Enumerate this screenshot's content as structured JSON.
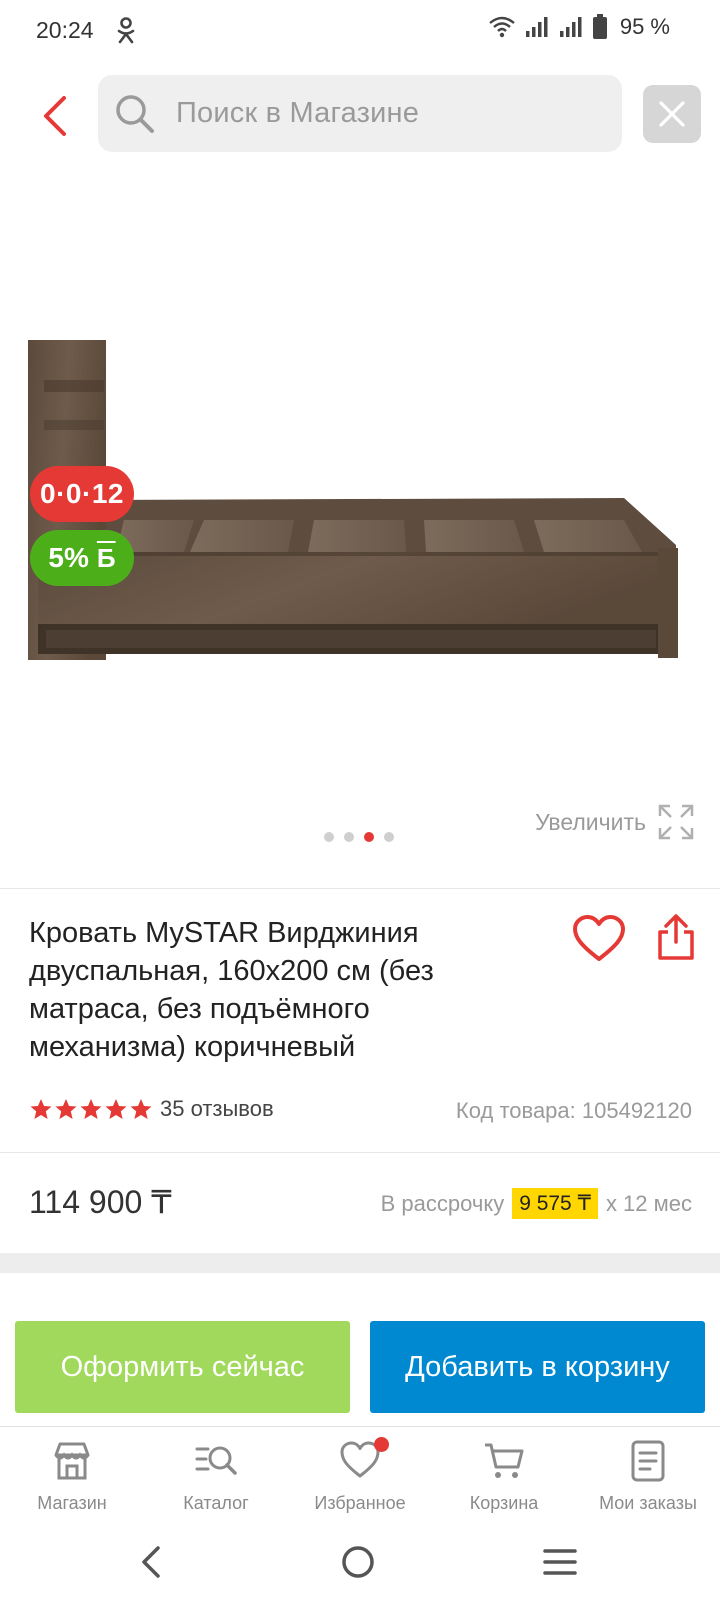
{
  "status_bar": {
    "time": "20:24",
    "battery_percent": "95 %",
    "icons": [
      "odnoklassniki-icon",
      "wifi-icon",
      "signal-icon",
      "signal-icon",
      "battery-icon"
    ]
  },
  "header": {
    "search_placeholder": "Поиск в Магазине"
  },
  "gallery": {
    "badge_installment": "0·0·12",
    "badge_bonus_value": "5%",
    "badge_bonus_symbol": "Б",
    "total_images": 4,
    "active_image_index": 3,
    "zoom_label": "Увеличить"
  },
  "product": {
    "title": "Кровать MySTAR Вирджиния двуспальная, 160х200 см (без матраса, без подъёмного механизма) коричневый",
    "rating": 5,
    "reviews": "35 отзывов",
    "sku": "Код товара: 105492120"
  },
  "price": {
    "value": "114 900 ₸",
    "installment_prefix": "В рассрочку",
    "installment_amount": "9 575 ₸",
    "installment_suffix": "х 12 мес"
  },
  "actions": {
    "buy_now": "Оформить сейчас",
    "add_to_cart": "Добавить в корзину"
  },
  "bottom_nav": [
    {
      "label": "Магазин",
      "icon": "store-icon"
    },
    {
      "label": "Каталог",
      "icon": "catalog-search-icon"
    },
    {
      "label": "Избранное",
      "icon": "heart-icon"
    },
    {
      "label": "Корзина",
      "icon": "cart-icon"
    },
    {
      "label": "Мои заказы",
      "icon": "orders-icon"
    }
  ],
  "colors": {
    "accent_red": "#e53935",
    "buy_now_green": "#a0d95b",
    "add_cart_blue": "#0089d1",
    "installment_yellow": "#ffd600"
  }
}
